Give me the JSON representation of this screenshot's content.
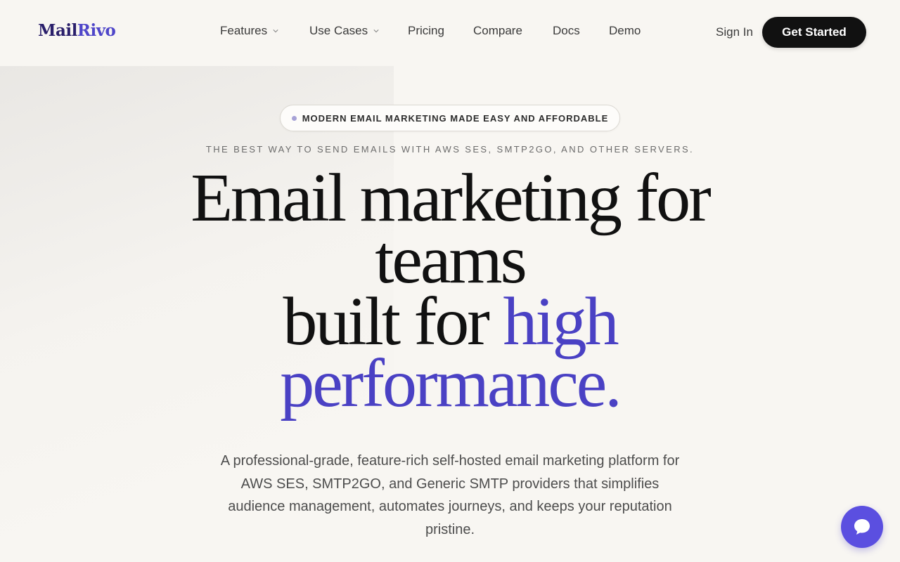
{
  "brand": {
    "logo_part1": "Mail",
    "logo_part2": "Rivo",
    "accent_color": "#4a41c4"
  },
  "nav": {
    "items": [
      {
        "label": "Features",
        "dropdown": true
      },
      {
        "label": "Use Cases",
        "dropdown": true
      },
      {
        "label": "Pricing",
        "dropdown": false
      },
      {
        "label": "Compare",
        "dropdown": false
      },
      {
        "label": "Docs",
        "dropdown": false
      },
      {
        "label": "Demo",
        "dropdown": false
      }
    ],
    "sign_in": "Sign In",
    "cta": "Get Started"
  },
  "hero": {
    "badge": "MODERN EMAIL MARKETING MADE EASY AND AFFORDABLE",
    "subtitle": "THE BEST WAY TO SEND EMAILS WITH AWS SES, SMTP2GO, AND OTHER SERVERS.",
    "headline_line1": "Email marketing for",
    "headline_line2": "teams",
    "headline_line3": "built for ",
    "headline_accent1": "high",
    "headline_accent2": "performance.",
    "description": "A professional-grade, feature-rich self-hosted email marketing platform for AWS SES, SMTP2GO, and Generic SMTP providers that simplifies audience management, automates journeys, and keeps your reputation pristine."
  },
  "widgets": {
    "chat_icon": "chat-bubble-icon",
    "chat_color": "#5b4fe0"
  }
}
